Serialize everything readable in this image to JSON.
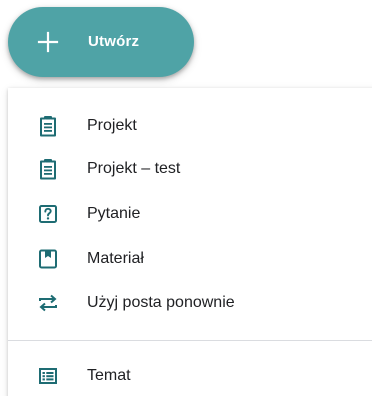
{
  "colors": {
    "accent": "#4fa3a6",
    "icon": "#1e6c73",
    "text": "#202124"
  },
  "create_button": {
    "label": "Utwórz",
    "icon": "plus-icon"
  },
  "menu": {
    "items": [
      {
        "label": "Projekt",
        "icon": "assignment-icon"
      },
      {
        "label": "Projekt – test",
        "icon": "assignment-icon"
      },
      {
        "label": "Pytanie",
        "icon": "question-icon"
      },
      {
        "label": "Materiał",
        "icon": "book-icon"
      },
      {
        "label": "Użyj posta ponownie",
        "icon": "reuse-icon"
      }
    ],
    "topic": {
      "label": "Temat",
      "icon": "topic-list-icon"
    }
  }
}
